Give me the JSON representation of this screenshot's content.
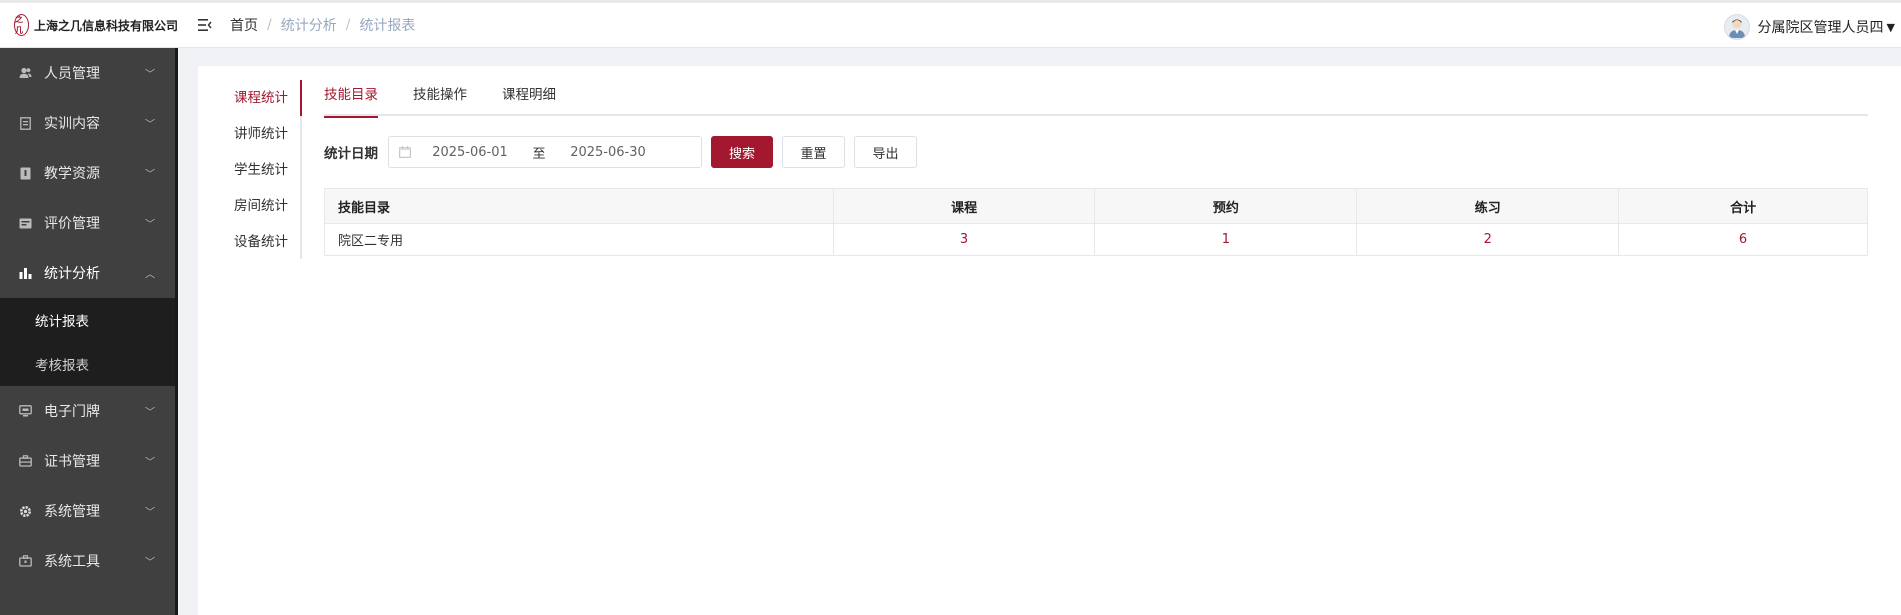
{
  "app": {
    "logo_mark": "之几",
    "logo_text": "上海之几信息科技有限公司",
    "accent": "#a3172f"
  },
  "header": {
    "breadcrumb": [
      "首页",
      "统计分析",
      "统计报表"
    ],
    "user_name": "分属院区管理人员四"
  },
  "sidebar": {
    "items": [
      {
        "label": "人员管理",
        "icon": "users-icon"
      },
      {
        "label": "实训内容",
        "icon": "document-icon"
      },
      {
        "label": "教学资源",
        "icon": "book-icon"
      },
      {
        "label": "评价管理",
        "icon": "card-icon"
      },
      {
        "label": "统计分析",
        "icon": "bar-chart-icon"
      },
      {
        "label": "电子门牌",
        "icon": "monitor-icon"
      },
      {
        "label": "证书管理",
        "icon": "briefcase-icon"
      },
      {
        "label": "系统管理",
        "icon": "gear-icon"
      },
      {
        "label": "系统工具",
        "icon": "toolbox-icon"
      }
    ],
    "submenu": [
      "统计报表",
      "考核报表"
    ]
  },
  "leftnav": [
    "课程统计",
    "讲师统计",
    "学生统计",
    "房间统计",
    "设备统计"
  ],
  "tabs": [
    "技能目录",
    "技能操作",
    "课程明细"
  ],
  "filter": {
    "label": "统计日期",
    "start": "2025-06-01",
    "separator": "至",
    "end": "2025-06-30",
    "search": "搜索",
    "reset": "重置",
    "export": "导出"
  },
  "table": {
    "headers": [
      "技能目录",
      "课程",
      "预约",
      "练习",
      "合计"
    ],
    "rows": [
      [
        "院区二专用",
        "3",
        "1",
        "2",
        "6"
      ]
    ]
  }
}
